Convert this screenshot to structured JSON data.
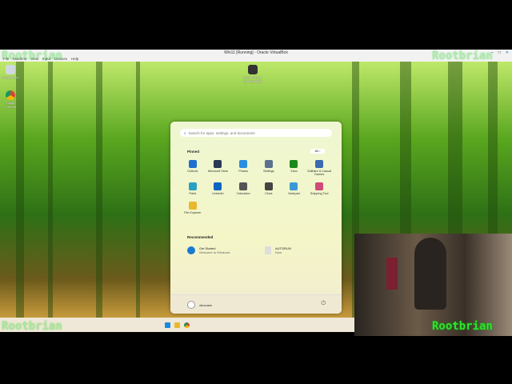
{
  "window": {
    "title": "Win11 [Running] - Oracle VirtualBox",
    "controls": [
      "–",
      "□",
      "✕"
    ]
  },
  "menu": [
    "File",
    "Machine",
    "View",
    "Input",
    "Devices",
    "Help"
  ],
  "desktop_icons": [
    {
      "label": "Recycle Bin"
    },
    {
      "label": "Google Chrome"
    },
    {
      "label": "Super Duper Secure Mode"
    }
  ],
  "start": {
    "search_placeholder": "Search for apps, settings, and documents",
    "pinned_label": "Pinned",
    "all_label": "All  ›",
    "pinned": [
      {
        "label": "Outlook",
        "color": "#1e6fd0"
      },
      {
        "label": "Microsoft Store",
        "color": "#2a3a55"
      },
      {
        "label": "Photos",
        "color": "#2a8ee0"
      },
      {
        "label": "Settings",
        "color": "#5a7090"
      },
      {
        "label": "Xbox",
        "color": "#1a8a1a"
      },
      {
        "label": "Solitaire & Casual Games",
        "color": "#3a6ab0"
      },
      {
        "label": "Paint",
        "color": "#2aa0c0"
      },
      {
        "label": "LinkedIn",
        "color": "#0a66c2"
      },
      {
        "label": "Calculator",
        "color": "#555"
      },
      {
        "label": "Clock",
        "color": "#444"
      },
      {
        "label": "Notepad",
        "color": "#3a9ad8"
      },
      {
        "label": "Snipping Tool",
        "color": "#d04a7a"
      },
      {
        "label": "File Explorer",
        "color": "#e8b830"
      }
    ],
    "recommended_label": "Recommended",
    "recommended": [
      {
        "title": "Get Started",
        "subtitle": "Welcome to Windows"
      },
      {
        "title": "AUTORUN",
        "subtitle": "Now"
      }
    ],
    "user": "vboxuser"
  },
  "watermark": "Rootbrian"
}
